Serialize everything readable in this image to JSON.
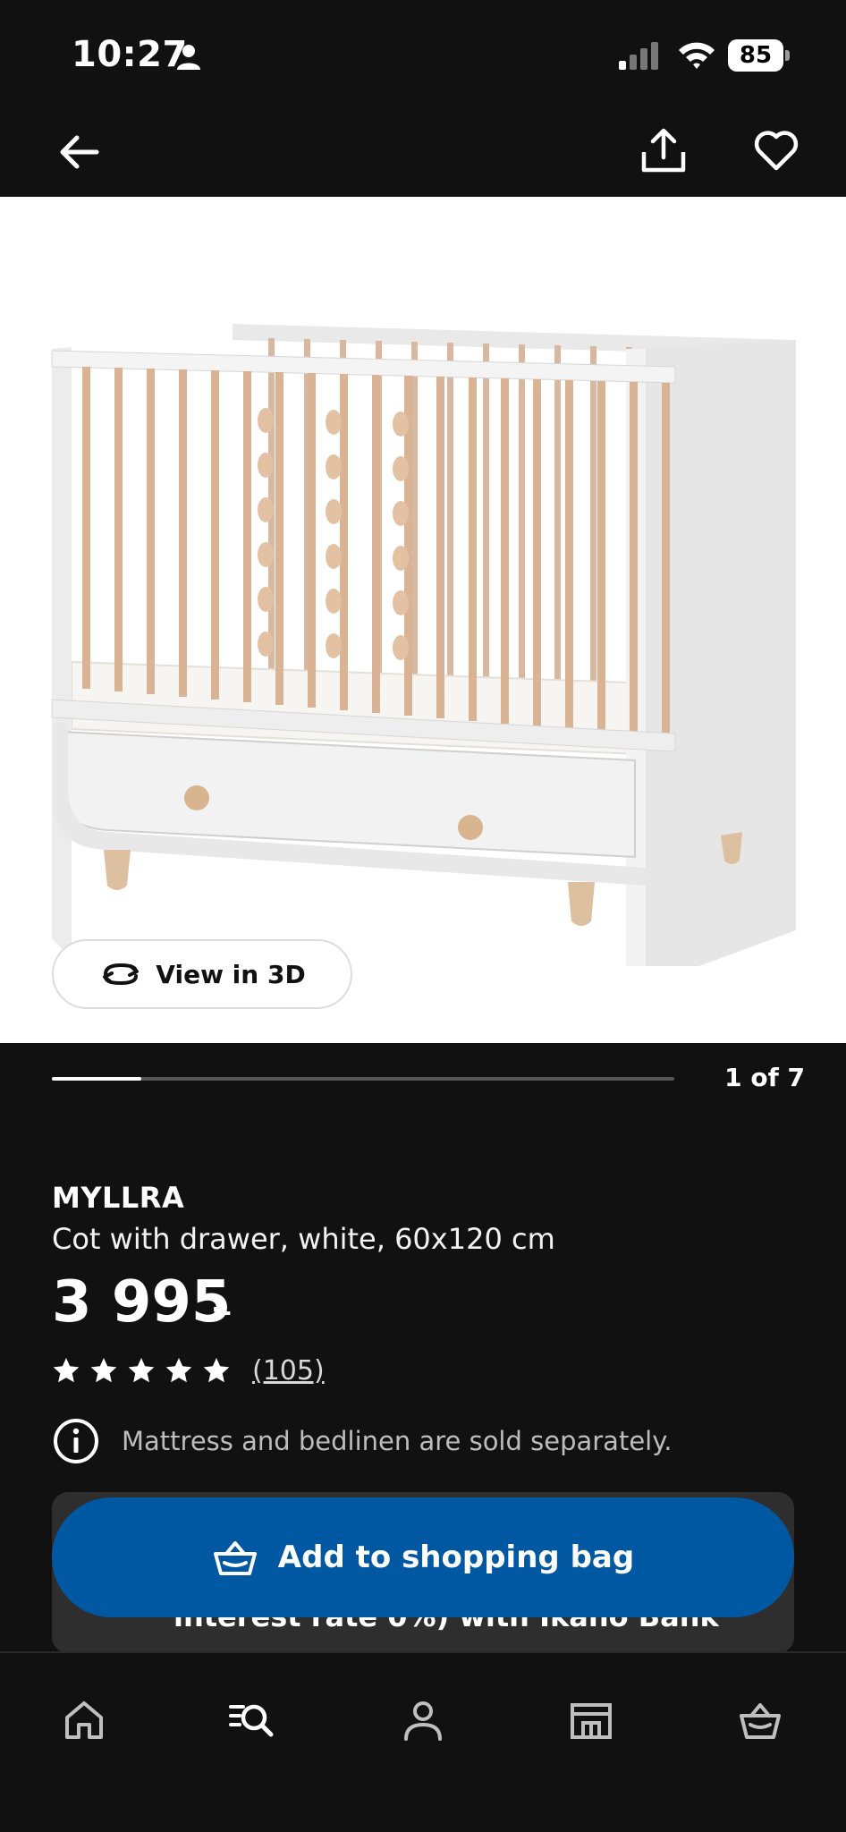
{
  "status_bar": {
    "time": "10:27",
    "battery_level": "85",
    "icons": [
      "person-icon",
      "signal-icon",
      "wifi-icon",
      "battery-icon"
    ]
  },
  "top_nav": {
    "icons": [
      "back-arrow-icon",
      "share-icon",
      "heart-icon"
    ]
  },
  "gallery": {
    "view_3d_label": "View in 3D",
    "counter": "1 of 7",
    "progress_fraction": 0.143
  },
  "product": {
    "name": "MYLLRA",
    "description": "Cot with drawer, white, 60x120 cm",
    "price": "3 995",
    "price_suffix": ":-",
    "rating_stars": 5,
    "review_count": "(105)",
    "notice": "Mattress and bedlinen are sold separately."
  },
  "finance_card": {
    "partial_text": "interest rate 0%) with Ikano Bank"
  },
  "cta": {
    "add_to_bag_label": "Add to shopping bag"
  },
  "tab_bar": {
    "items": [
      "home-icon",
      "search-list-icon",
      "profile-icon",
      "store-icon",
      "shopping-bag-icon"
    ]
  },
  "colors": {
    "background": "#111111",
    "accent_blue": "#0058a3",
    "card": "#2e2e2e",
    "image_bg": "#ffffff"
  }
}
